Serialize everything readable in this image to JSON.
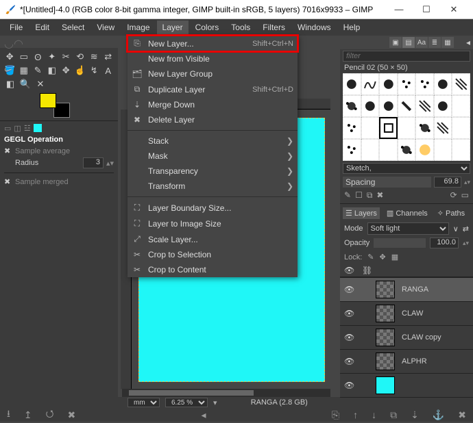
{
  "title": "*[Untitled]-4.0 (RGB color 8-bit gamma integer, GIMP built-in sRGB, 5 layers) 7016x9933 – GIMP",
  "menubar": [
    "File",
    "Edit",
    "Select",
    "View",
    "Image",
    "Layer",
    "Colors",
    "Tools",
    "Filters",
    "Windows",
    "Help"
  ],
  "menubar_open_index": 5,
  "dropdown": {
    "groups": [
      [
        {
          "icon": "⎘",
          "label": "New Layer...",
          "shortcut": "Shift+Ctrl+N",
          "hl": true
        },
        {
          "icon": "",
          "label": "New from Visible",
          "shortcut": ""
        },
        {
          "icon": "🗂",
          "label": "New Layer Group",
          "shortcut": ""
        },
        {
          "icon": "⧉",
          "label": "Duplicate Layer",
          "shortcut": "Shift+Ctrl+D"
        },
        {
          "icon": "⇣",
          "label": "Merge Down",
          "shortcut": ""
        },
        {
          "icon": "✖",
          "label": "Delete Layer",
          "shortcut": ""
        }
      ],
      [
        {
          "icon": "",
          "label": "Stack",
          "sub": true
        },
        {
          "icon": "",
          "label": "Mask",
          "sub": true
        },
        {
          "icon": "",
          "label": "Transparency",
          "sub": true
        },
        {
          "icon": "",
          "label": "Transform",
          "sub": true
        }
      ],
      [
        {
          "icon": "⛶",
          "label": "Layer Boundary Size...",
          "shortcut": ""
        },
        {
          "icon": "⛶",
          "label": "Layer to Image Size",
          "shortcut": ""
        },
        {
          "icon": "⤢",
          "label": "Scale Layer...",
          "shortcut": ""
        },
        {
          "icon": "✂",
          "label": "Crop to Selection",
          "shortcut": ""
        },
        {
          "icon": "✂",
          "label": "Crop to Content",
          "shortcut": ""
        }
      ]
    ]
  },
  "tool_options": {
    "title": "GEGL Operation",
    "sample_avg": "Sample average",
    "radius_label": "Radius",
    "radius_value": "3",
    "sample_merged": "Sample merged"
  },
  "right": {
    "filter_ph": "filter",
    "brush_name": "Pencil 02 (50 × 50)",
    "brush_preset_sel": "Sketch,",
    "spacing_label": "Spacing",
    "spacing_val": "69.8",
    "tabs": {
      "layers": "Layers",
      "channels": "Channels",
      "paths": "Paths"
    },
    "mode_label": "Mode",
    "mode_value": "Soft light",
    "opacity_label": "Opacity",
    "opacity_val": "100.0",
    "lock_label": "Lock:"
  },
  "layers": [
    {
      "name": "RANGA",
      "sel": true,
      "cyan": false
    },
    {
      "name": "CLAW",
      "sel": false,
      "cyan": false
    },
    {
      "name": "CLAW copy",
      "sel": false,
      "cyan": false
    },
    {
      "name": "ALPHR",
      "sel": false,
      "cyan": false
    },
    {
      "name": "",
      "sel": false,
      "cyan": true
    }
  ],
  "status": {
    "unit": "mm",
    "zoom": "6.25 %",
    "info": "RANGA (2.8 GB)"
  }
}
